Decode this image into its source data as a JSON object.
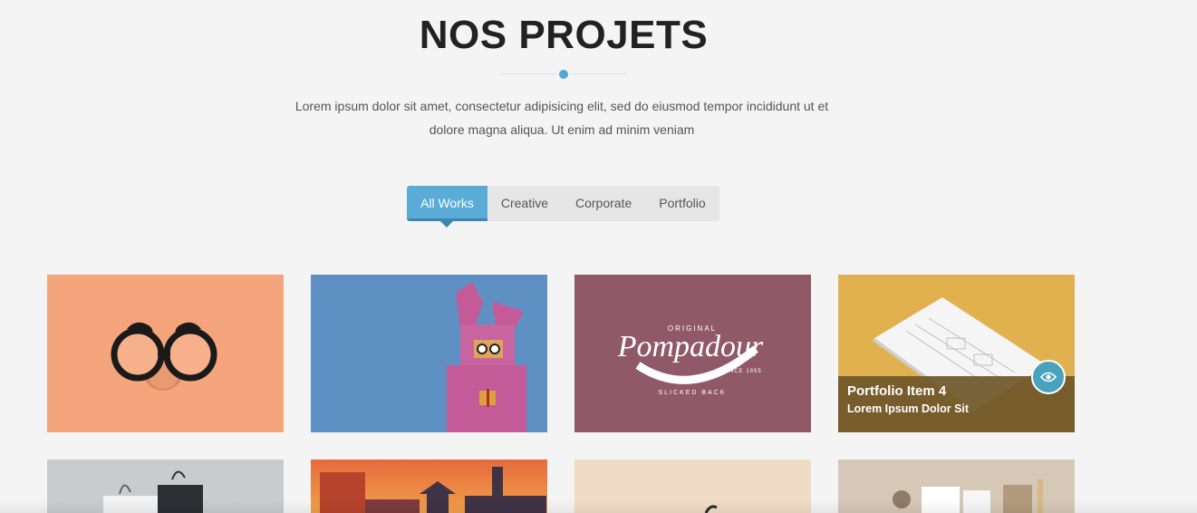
{
  "section": {
    "title": "NOS PROJETS",
    "subtitle": "Lorem ipsum dolor sit amet, consectetur adipisicing elit, sed do eiusmod tempor incididunt ut et dolore magna aliqua. Ut enim ad minim veniam"
  },
  "filters": {
    "active": "All Works",
    "items": [
      "All Works",
      "Creative",
      "Corporate",
      "Portfolio"
    ]
  },
  "portfolio": {
    "hover_item": {
      "title": "Portfolio Item 4",
      "subtitle": "Lorem Ipsum Dolor Sit"
    },
    "logo_text": {
      "top": "ORIGINAL",
      "main": "Pompadour",
      "right": "SINCE 1955",
      "bottom": "SLICKED BACK"
    }
  },
  "colors": {
    "accent": "#5aacd6",
    "card1": "#f4a57c",
    "card2": "#5f90c4",
    "card3": "#8f5968",
    "card4": "#e1b150",
    "overlay": "#6e5628"
  }
}
